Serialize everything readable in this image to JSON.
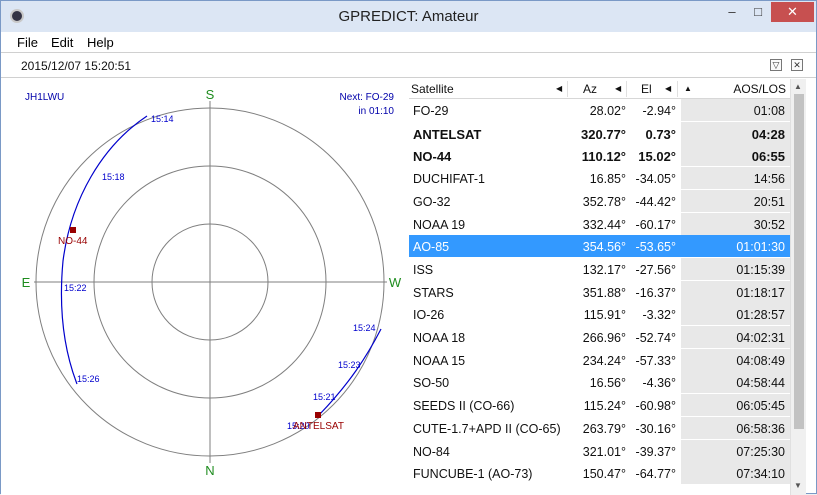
{
  "window": {
    "title": "GPREDICT: Amateur",
    "minimize": "–",
    "maximize": "□",
    "close": "✕"
  },
  "menu": {
    "file": "File",
    "edit": "Edit",
    "help": "Help"
  },
  "timebar": {
    "time": "2015/12/07 15:20:51",
    "collapse_icon": "▽",
    "close_icon": "✕"
  },
  "polar": {
    "station": "JH1LWU",
    "next_label": "Next: FO-29",
    "next_time": "in 01:10",
    "compass": {
      "s": "S",
      "n": "N",
      "e": "E",
      "w": "W"
    },
    "track1": {
      "times": [
        "15:14",
        "15:18",
        "15:22",
        "15:26"
      ],
      "object": "NO-44"
    },
    "track2": {
      "times": [
        "15:24",
        "15:23",
        "15:21",
        "15:20"
      ],
      "object": "ANTELSAT"
    },
    "colors": {
      "track": "#0000cc",
      "object": "#990000",
      "compass": "#1e8c1e",
      "grid": "#7f7f7f"
    }
  },
  "table": {
    "headers": {
      "satellite": "Satellite",
      "az": "Az",
      "el": "El",
      "aos": "AOS/LOS"
    },
    "rows": [
      {
        "name": "FO-29",
        "az": "28.02°",
        "el": "-2.94°",
        "aos": "01:08",
        "bold": false
      },
      {
        "name": "ANTELSAT",
        "az": "320.77°",
        "el": "0.73°",
        "aos": "04:28",
        "bold": true
      },
      {
        "name": "NO-44",
        "az": "110.12°",
        "el": "15.02°",
        "aos": "06:55",
        "bold": true
      },
      {
        "name": "DUCHIFAT-1",
        "az": "16.85°",
        "el": "-34.05°",
        "aos": "14:56",
        "bold": false
      },
      {
        "name": "GO-32",
        "az": "352.78°",
        "el": "-44.42°",
        "aos": "20:51",
        "bold": false
      },
      {
        "name": "NOAA 19",
        "az": "332.44°",
        "el": "-60.17°",
        "aos": "30:52",
        "bold": false
      },
      {
        "name": "AO-85",
        "az": "354.56°",
        "el": "-53.65°",
        "aos": "01:01:30",
        "bold": false,
        "selected": true
      },
      {
        "name": "ISS",
        "az": "132.17°",
        "el": "-27.56°",
        "aos": "01:15:39",
        "bold": false
      },
      {
        "name": "STARS",
        "az": "351.88°",
        "el": "-16.37°",
        "aos": "01:18:17",
        "bold": false
      },
      {
        "name": "IO-26",
        "az": "115.91°",
        "el": "-3.32°",
        "aos": "01:28:57",
        "bold": false
      },
      {
        "name": "NOAA 18",
        "az": "266.96°",
        "el": "-52.74°",
        "aos": "04:02:31",
        "bold": false
      },
      {
        "name": "NOAA 15",
        "az": "234.24°",
        "el": "-57.33°",
        "aos": "04:08:49",
        "bold": false
      },
      {
        "name": "SO-50",
        "az": "16.56°",
        "el": "-4.36°",
        "aos": "04:58:44",
        "bold": false
      },
      {
        "name": "SEEDS II (CO-66)",
        "az": "115.24°",
        "el": "-60.98°",
        "aos": "06:05:45",
        "bold": false
      },
      {
        "name": "CUTE-1.7+APD II (CO-65)",
        "az": "263.79°",
        "el": "-30.16°",
        "aos": "06:58:36",
        "bold": false
      },
      {
        "name": "NO-84",
        "az": "321.01°",
        "el": "-39.37°",
        "aos": "07:25:30",
        "bold": false
      },
      {
        "name": "FUNCUBE-1 (AO-73)",
        "az": "150.47°",
        "el": "-64.77°",
        "aos": "07:34:10",
        "bold": false
      }
    ]
  }
}
